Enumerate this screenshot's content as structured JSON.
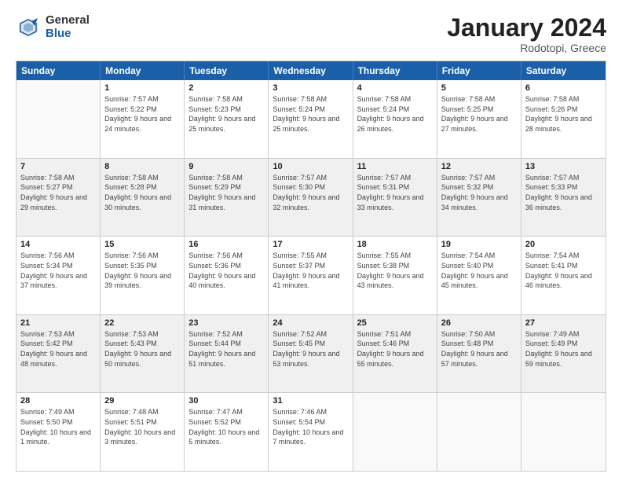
{
  "header": {
    "logo_general": "General",
    "logo_blue": "Blue",
    "title": "January 2024",
    "location": "Rodotopi, Greece"
  },
  "weekdays": [
    "Sunday",
    "Monday",
    "Tuesday",
    "Wednesday",
    "Thursday",
    "Friday",
    "Saturday"
  ],
  "rows": [
    {
      "shaded": false,
      "cells": [
        {
          "day": "",
          "empty": true
        },
        {
          "day": "1",
          "sunrise": "7:57 AM",
          "sunset": "5:22 PM",
          "daylight": "9 hours and 24 minutes."
        },
        {
          "day": "2",
          "sunrise": "7:58 AM",
          "sunset": "5:23 PM",
          "daylight": "9 hours and 25 minutes."
        },
        {
          "day": "3",
          "sunrise": "7:58 AM",
          "sunset": "5:24 PM",
          "daylight": "9 hours and 25 minutes."
        },
        {
          "day": "4",
          "sunrise": "7:58 AM",
          "sunset": "5:24 PM",
          "daylight": "9 hours and 26 minutes."
        },
        {
          "day": "5",
          "sunrise": "7:58 AM",
          "sunset": "5:25 PM",
          "daylight": "9 hours and 27 minutes."
        },
        {
          "day": "6",
          "sunrise": "7:58 AM",
          "sunset": "5:26 PM",
          "daylight": "9 hours and 28 minutes."
        }
      ]
    },
    {
      "shaded": true,
      "cells": [
        {
          "day": "7",
          "sunrise": "7:58 AM",
          "sunset": "5:27 PM",
          "daylight": "9 hours and 29 minutes."
        },
        {
          "day": "8",
          "sunrise": "7:58 AM",
          "sunset": "5:28 PM",
          "daylight": "9 hours and 30 minutes."
        },
        {
          "day": "9",
          "sunrise": "7:58 AM",
          "sunset": "5:29 PM",
          "daylight": "9 hours and 31 minutes."
        },
        {
          "day": "10",
          "sunrise": "7:57 AM",
          "sunset": "5:30 PM",
          "daylight": "9 hours and 32 minutes."
        },
        {
          "day": "11",
          "sunrise": "7:57 AM",
          "sunset": "5:31 PM",
          "daylight": "9 hours and 33 minutes."
        },
        {
          "day": "12",
          "sunrise": "7:57 AM",
          "sunset": "5:32 PM",
          "daylight": "9 hours and 34 minutes."
        },
        {
          "day": "13",
          "sunrise": "7:57 AM",
          "sunset": "5:33 PM",
          "daylight": "9 hours and 36 minutes."
        }
      ]
    },
    {
      "shaded": false,
      "cells": [
        {
          "day": "14",
          "sunrise": "7:56 AM",
          "sunset": "5:34 PM",
          "daylight": "9 hours and 37 minutes."
        },
        {
          "day": "15",
          "sunrise": "7:56 AM",
          "sunset": "5:35 PM",
          "daylight": "9 hours and 39 minutes."
        },
        {
          "day": "16",
          "sunrise": "7:56 AM",
          "sunset": "5:36 PM",
          "daylight": "9 hours and 40 minutes."
        },
        {
          "day": "17",
          "sunrise": "7:55 AM",
          "sunset": "5:37 PM",
          "daylight": "9 hours and 41 minutes."
        },
        {
          "day": "18",
          "sunrise": "7:55 AM",
          "sunset": "5:38 PM",
          "daylight": "9 hours and 43 minutes."
        },
        {
          "day": "19",
          "sunrise": "7:54 AM",
          "sunset": "5:40 PM",
          "daylight": "9 hours and 45 minutes."
        },
        {
          "day": "20",
          "sunrise": "7:54 AM",
          "sunset": "5:41 PM",
          "daylight": "9 hours and 46 minutes."
        }
      ]
    },
    {
      "shaded": true,
      "cells": [
        {
          "day": "21",
          "sunrise": "7:53 AM",
          "sunset": "5:42 PM",
          "daylight": "9 hours and 48 minutes."
        },
        {
          "day": "22",
          "sunrise": "7:53 AM",
          "sunset": "5:43 PM",
          "daylight": "9 hours and 50 minutes."
        },
        {
          "day": "23",
          "sunrise": "7:52 AM",
          "sunset": "5:44 PM",
          "daylight": "9 hours and 51 minutes."
        },
        {
          "day": "24",
          "sunrise": "7:52 AM",
          "sunset": "5:45 PM",
          "daylight": "9 hours and 53 minutes."
        },
        {
          "day": "25",
          "sunrise": "7:51 AM",
          "sunset": "5:46 PM",
          "daylight": "9 hours and 55 minutes."
        },
        {
          "day": "26",
          "sunrise": "7:50 AM",
          "sunset": "5:48 PM",
          "daylight": "9 hours and 57 minutes."
        },
        {
          "day": "27",
          "sunrise": "7:49 AM",
          "sunset": "5:49 PM",
          "daylight": "9 hours and 59 minutes."
        }
      ]
    },
    {
      "shaded": false,
      "cells": [
        {
          "day": "28",
          "sunrise": "7:49 AM",
          "sunset": "5:50 PM",
          "daylight": "10 hours and 1 minute."
        },
        {
          "day": "29",
          "sunrise": "7:48 AM",
          "sunset": "5:51 PM",
          "daylight": "10 hours and 3 minutes."
        },
        {
          "day": "30",
          "sunrise": "7:47 AM",
          "sunset": "5:52 PM",
          "daylight": "10 hours and 5 minutes."
        },
        {
          "day": "31",
          "sunrise": "7:46 AM",
          "sunset": "5:54 PM",
          "daylight": "10 hours and 7 minutes."
        },
        {
          "day": "",
          "empty": true
        },
        {
          "day": "",
          "empty": true
        },
        {
          "day": "",
          "empty": true
        }
      ]
    }
  ]
}
